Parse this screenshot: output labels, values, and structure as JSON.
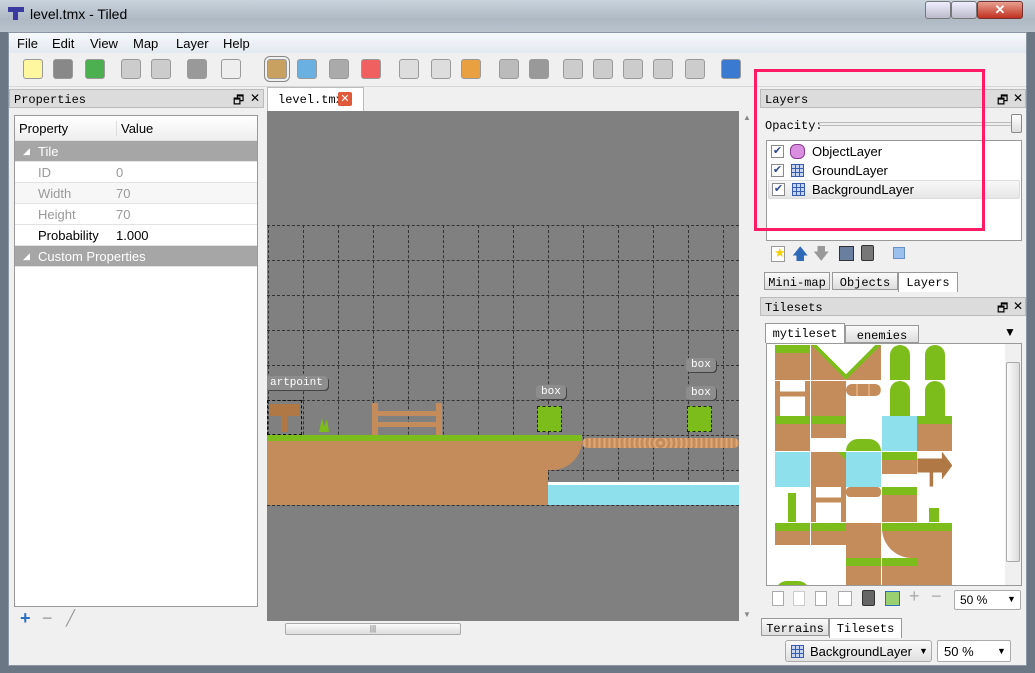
{
  "window": {
    "title": "level.tmx - Tiled",
    "controls": [
      "minimize",
      "maximize",
      "close"
    ]
  },
  "menu": [
    "File",
    "Edit",
    "View",
    "Map",
    "Layer",
    "Help"
  ],
  "toolbar": [
    "new-icon",
    "open-icon",
    "save-icon",
    "undo-icon",
    "redo-icon",
    "commands-icon",
    "random-icon",
    "stamp-brush-icon",
    "terrain-brush-icon",
    "bucket-fill-icon",
    "eraser-icon",
    "rect-select-icon",
    "magic-wand-icon",
    "select-same-tile-icon",
    "select-objects-icon",
    "edit-polygons-icon",
    "insert-rectangle-icon",
    "insert-ellipse-icon",
    "insert-polygon-icon",
    "insert-polyline-icon",
    "insert-tile-icon",
    "move-icon"
  ],
  "properties": {
    "title": "Properties",
    "headers": [
      "Property",
      "Value"
    ],
    "groups": [
      {
        "name": "Tile",
        "rows": [
          {
            "k": "ID",
            "v": "0"
          },
          {
            "k": "Width",
            "v": "70"
          },
          {
            "k": "Height",
            "v": "70"
          },
          {
            "k": "Probability",
            "v": "1.000"
          }
        ]
      },
      {
        "name": "Custom Properties",
        "rows": []
      }
    ]
  },
  "document_tab": "level.tmx",
  "map": {
    "objects": [
      {
        "name": "artpoint"
      },
      {
        "name": "box"
      },
      {
        "name": "box"
      },
      {
        "name": "box"
      }
    ]
  },
  "layers": {
    "title": "Layers",
    "opacity_label": "Opacity:",
    "opacity": 1.0,
    "items": [
      {
        "name": "ObjectLayer",
        "type": "object",
        "visible": true
      },
      {
        "name": "GroundLayer",
        "type": "tile",
        "visible": true
      },
      {
        "name": "BackgroundLayer",
        "type": "tile",
        "visible": true,
        "selected": true
      }
    ],
    "tabs": [
      "Mini-map",
      "Objects",
      "Layers"
    ],
    "active_tab": "Layers"
  },
  "tilesets": {
    "title": "Tilesets",
    "tabs": [
      "mytileset",
      "enemies"
    ],
    "active_tab": "mytileset",
    "zoom": "50 %",
    "bottom_tabs": [
      "Terrains",
      "Tilesets"
    ],
    "active_bottom_tab": "Tilesets",
    "tiles": [
      [
        "G",
        "SL",
        "SR",
        "P",
        "P"
      ],
      [
        "F",
        "D",
        "L",
        "P",
        "P"
      ],
      [
        "G",
        "GS",
        "B",
        "W",
        "G"
      ],
      [
        "W",
        "DR",
        "W",
        "GS",
        "S"
      ],
      [
        "C",
        "F",
        "LOG",
        "G",
        "GR"
      ],
      [
        "GS",
        "GS",
        "D",
        "DL",
        "G"
      ],
      [
        "B",
        "",
        "G",
        "G",
        "D"
      ]
    ]
  },
  "status": {
    "layer": "BackgroundLayer",
    "zoom": "50 %"
  },
  "colors": {
    "highlight": "#ff1a66",
    "canvas": "#808080",
    "grass": "#7cbc1b",
    "dirt": "#c48c5a",
    "water": "#8ee0ec"
  }
}
